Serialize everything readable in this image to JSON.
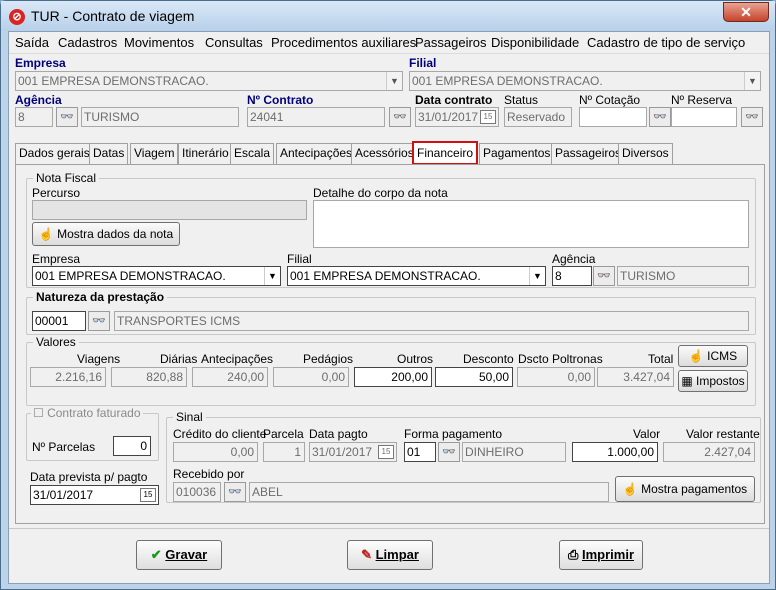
{
  "window": {
    "title": "TUR - Contrato de viagem",
    "close": "✕"
  },
  "menu": [
    "Saída",
    "Cadastros",
    "Movimentos",
    "Consultas",
    "Procedimentos auxiliares",
    "Passageiros",
    "Disponibilidade",
    "Cadastro de tipo de serviço"
  ],
  "header": {
    "empresa_label": "Empresa",
    "empresa_value": "001 EMPRESA DEMONSTRACAO.",
    "filial_label": "Filial",
    "filial_value": "001 EMPRESA DEMONSTRACAO.",
    "agencia_label": "Agência",
    "agencia_code": "8",
    "agencia_name": "TURISMO",
    "contrato_label": "Nº Contrato",
    "contrato_value": "24041",
    "data_contrato_label": "Data contrato",
    "data_contrato_value": "31/01/2017",
    "status_label": "Status",
    "status_value": "Reservado",
    "cotacao_label": "Nº Cotação",
    "reserva_label": "Nº Reserva"
  },
  "tabs": [
    "Dados gerais",
    "Datas",
    "Viagem",
    "Itinerário",
    "Escala",
    "Antecipações",
    "Acessórios",
    "Financeiro",
    "Pagamentos",
    "Passageiros",
    "Diversos"
  ],
  "nota_fiscal": {
    "title": "Nota Fiscal",
    "percurso_label": "Percurso",
    "percurso_value": "",
    "detalhe_label": "Detalhe do corpo da nota",
    "mostra_dados_button": "Mostra dados da nota",
    "empresa_label": "Empresa",
    "empresa_value": "001 EMPRESA DEMONSTRACAO.",
    "filial_label": "Filial",
    "filial_value": "001 EMPRESA DEMONSTRACAO.",
    "agencia_label": "Agência",
    "agencia_code": "8",
    "agencia_name": "TURISMO"
  },
  "natureza": {
    "title": "Natureza da prestação",
    "code": "00001",
    "description": "TRANSPORTES ICMS"
  },
  "valores": {
    "title": "Valores",
    "viagens_label": "Viagens",
    "viagens": "2.216,16",
    "diarias_label": "Diárias",
    "diarias": "820,88",
    "antecipacoes_label": "Antecipações",
    "antecipacoes": "240,00",
    "pedagios_label": "Pedágios",
    "pedagios": "0,00",
    "outros_label": "Outros",
    "outros": "200,00",
    "desconto_label": "Desconto",
    "desconto": "50,00",
    "dscto_label": "Dscto Poltronas",
    "dscto": "0,00",
    "total_label": "Total",
    "total": "3.427,04",
    "icms_button": "ICMS",
    "impostos_button": "Impostos"
  },
  "faturado": {
    "contrato_faturado_label": "Contrato faturado",
    "parcelas_label": "Nº Parcelas",
    "parcelas_value": "0",
    "data_prevista_label": "Data prevista p/ pagto",
    "data_prevista_value": "31/01/2017"
  },
  "sinal": {
    "title": "Sinal",
    "credito_label": "Crédito do cliente",
    "credito": "0,00",
    "parcela_label": "Parcela",
    "parcela": "1",
    "data_pagto_label": "Data pagto",
    "data_pagto": "31/01/2017",
    "forma_label": "Forma pagamento",
    "forma_code": "01",
    "forma_name": "DINHEIRO",
    "valor_label": "Valor",
    "valor": "1.000,00",
    "restante_label": "Valor restante",
    "restante": "2.427,04",
    "recebido_label": "Recebido por",
    "recebido_code": "010036",
    "recebido_name": "ABEL",
    "mostra_pagamentos_button": "Mostra pagamentos"
  },
  "footer": {
    "gravar": "Gravar",
    "limpar": "Limpar",
    "imprimir": "Imprimir"
  }
}
